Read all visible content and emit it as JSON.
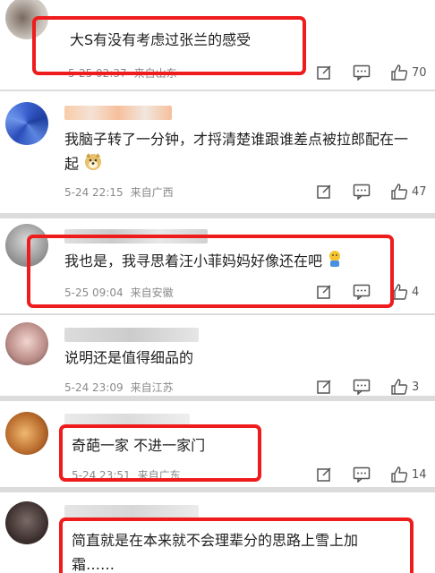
{
  "comments": [
    {
      "text": "大S有没有考虑过张兰的感受",
      "time": "5-25 02:37",
      "location": "来自山东",
      "likes": "70"
    },
    {
      "text": "我脑子转了一分钟，才捋清楚谁跟谁差点被拉郎配在一起",
      "time": "5-24 22:15",
      "location": "来自广西",
      "likes": "47"
    },
    {
      "text": "我也是，我寻思着汪小菲妈妈好像还在吧",
      "time": "5-25 09:04",
      "location": "来自安徽",
      "likes": "4"
    },
    {
      "text": "说明还是值得细品的",
      "time": "5-24 23:09",
      "location": "来自江苏",
      "likes": "3"
    },
    {
      "text": "奇葩一家 不进一家门",
      "time": "5-24 23:51",
      "location": "来自广东",
      "likes": "14"
    },
    {
      "text": "简直就是在本来就不会理辈分的思路上雪上加霜……"
    }
  ],
  "icons": {
    "reply": "edit-icon",
    "comment": "comment-icon",
    "like": "thumbs-up-icon",
    "emoji_dog": "doge-emoji-icon",
    "emoji_pray": "facepalm-emoji-icon"
  },
  "colors": {
    "highlight_box": "#ee1c1c",
    "meta_text": "#8a8a8a",
    "body_text": "#1f1f1f"
  }
}
